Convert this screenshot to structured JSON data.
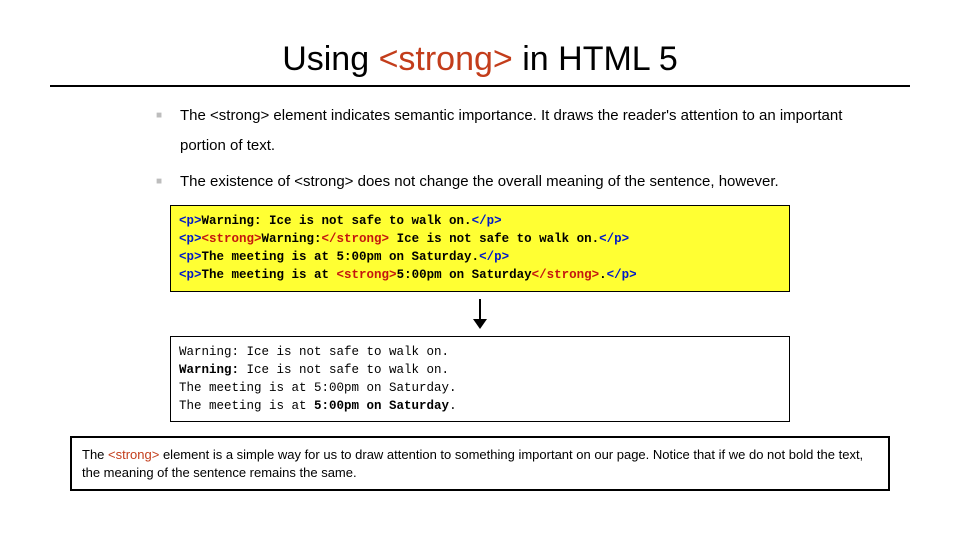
{
  "title_pre": "Using ",
  "title_tag": "<strong>",
  "title_post": " in HTML 5",
  "bullets": [
    "The <strong> element indicates semantic importance.  It draws the reader's attention to an important portion of text.",
    "The existence of <strong> does not change the overall meaning of the sentence, however."
  ],
  "code": {
    "l1_a": "<p>",
    "l1_b": "Warning: Ice is not safe to walk on.",
    "l1_c": "</p>",
    "l2_a": "<p>",
    "l2_b": "<strong>",
    "l2_c": "Warning:",
    "l2_d": "</strong>",
    "l2_e": " Ice is not safe to walk on.",
    "l2_f": "</p>",
    "l3_a": "<p>",
    "l3_b": "The meeting is at 5:00pm on Saturday.",
    "l3_c": "</p>",
    "l4_a": "<p>",
    "l4_b": "The meeting is at ",
    "l4_c": "<strong>",
    "l4_d": "5:00pm on Saturday",
    "l4_e": "</strong>",
    "l4_f": ".",
    "l4_g": "</p>"
  },
  "output": {
    "l1_a": "Warning: Ice is not safe to walk on.",
    "l2_a": "Warning:",
    "l2_b": " Ice is not safe to walk on.",
    "l3_a": "The meeting is at 5:00pm on Saturday.",
    "l4_a": "The meeting is at ",
    "l4_b": "5:00pm on Saturday",
    "l4_c": "."
  },
  "footnote_pre": "The ",
  "footnote_tag": "<strong>",
  "footnote_post": " element is a simple way for us to draw attention to something important on our page. Notice that if we do not bold the text, the meaning of the sentence remains the same."
}
